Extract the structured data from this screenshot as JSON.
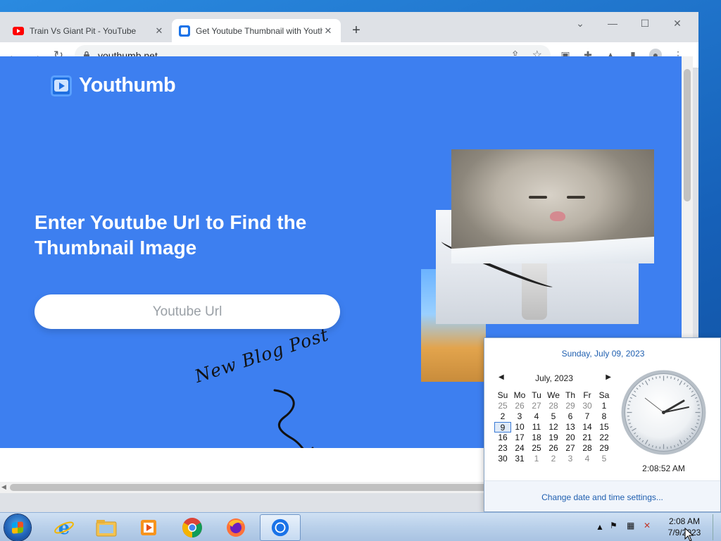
{
  "browser": {
    "tabs": [
      {
        "title": "Train Vs Giant Pit - YouTube",
        "favicon": "youtube-icon"
      },
      {
        "title": "Get Youtube Thumbnail with Youthumb",
        "favicon": "youthumb-icon",
        "active": true
      }
    ],
    "url": "youthumb.net"
  },
  "page": {
    "brand": "Youthumb",
    "headline": "Enter Youtube Url to Find the Thumbnail Image",
    "input_placeholder": "Youtube Url",
    "annotation": "New Blog Post",
    "background_color": "#3d7ff0"
  },
  "calendar_flyout": {
    "full_date": "Sunday, July 09, 2023",
    "month_label": "July, 2023",
    "weekdays": [
      "Su",
      "Mo",
      "Tu",
      "We",
      "Th",
      "Fr",
      "Sa"
    ],
    "days": [
      [
        "25",
        "26",
        "27",
        "28",
        "29",
        "30",
        "1"
      ],
      [
        "2",
        "3",
        "4",
        "5",
        "6",
        "7",
        "8"
      ],
      [
        "9",
        "10",
        "11",
        "12",
        "13",
        "14",
        "15"
      ],
      [
        "16",
        "17",
        "18",
        "19",
        "20",
        "21",
        "22"
      ],
      [
        "23",
        "24",
        "25",
        "26",
        "27",
        "28",
        "29"
      ],
      [
        "30",
        "31",
        "1",
        "2",
        "3",
        "4",
        "5"
      ]
    ],
    "selected_day": "9",
    "time": "2:08:52 AM",
    "settings_link": "Change date and time settings..."
  },
  "taskbar": {
    "time": "2:08 AM",
    "date": "7/9/2023",
    "apps": [
      "internet-explorer-icon",
      "file-explorer-icon",
      "media-player-icon",
      "chrome-icon",
      "firefox-icon",
      "chrome-active-icon"
    ]
  }
}
